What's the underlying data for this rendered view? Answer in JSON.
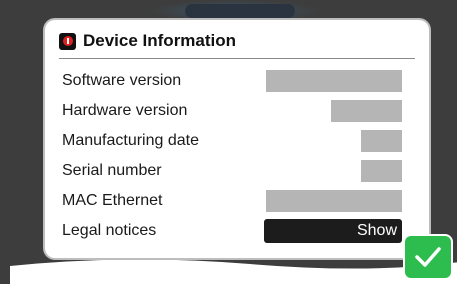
{
  "dialog": {
    "title": "Device Information",
    "icon": "info-icon"
  },
  "rows": [
    {
      "label": "Software version",
      "value": ""
    },
    {
      "label": "Hardware version",
      "value": ""
    },
    {
      "label": "Manufacturing date",
      "value": ""
    },
    {
      "label": "Serial number",
      "value": ""
    },
    {
      "label": "MAC Ethernet",
      "value": ""
    },
    {
      "label": "Legal notices",
      "action": "Show"
    }
  ],
  "confirm": {
    "icon": "checkmark-icon"
  },
  "colors": {
    "accent_green": "#2dbd4e",
    "redacted_grey": "#b5b5b5",
    "icon_red": "#e02020"
  }
}
